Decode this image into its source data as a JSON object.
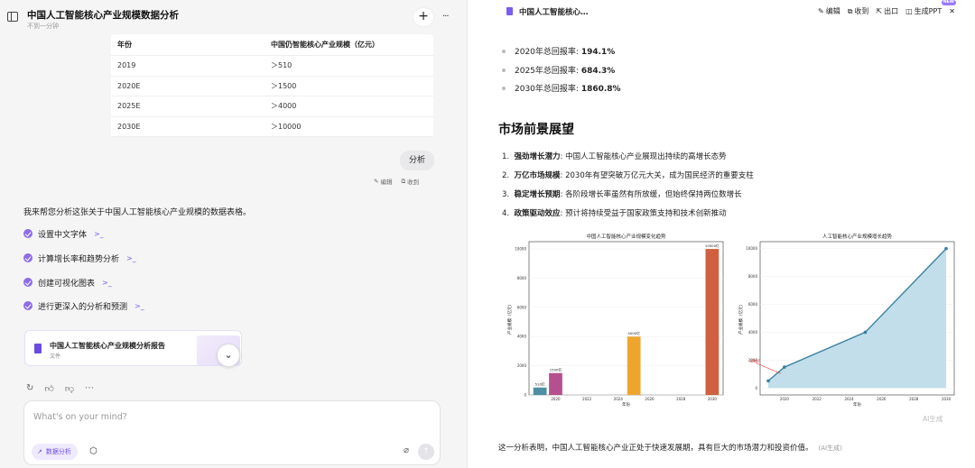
{
  "left": {
    "title": "中国人工智能核心产业规模数据分析",
    "subtitle": "不到一分钟",
    "table": {
      "headers": [
        "年份",
        "中国仍智能核心产业规模（亿元）"
      ],
      "rows": [
        [
          "2019",
          "＞510"
        ],
        [
          "2020E",
          "＞1500"
        ],
        [
          "2025E",
          "＞4000"
        ],
        [
          "2030E",
          "＞10000"
        ]
      ]
    },
    "user_message": "分析",
    "edit_label": "编辑",
    "collect_label": "收到",
    "ai_intro": "我来帮您分析这张关于中国人工智能核心产业规模的数据表格。",
    "steps": [
      "设置中文字体",
      "计算增长率和趋势分析",
      "创建可视化图表",
      "进行更深入的分析和预测"
    ],
    "file_card": {
      "title": "中国人工智能核心产业规模分析报告",
      "type": "文件"
    },
    "composer_placeholder": "What's on your mind?",
    "composer_tag": "数据分析"
  },
  "right": {
    "doc_title": "中国人工智能核心…",
    "header_buttons": [
      "编辑",
      "收到",
      "出口",
      "生成PPT"
    ],
    "new_badge": "NEW",
    "returns": [
      {
        "label": "2020年总回报率:",
        "value": "194.1%"
      },
      {
        "label": "2025年总回报率:",
        "value": "684.3%"
      },
      {
        "label": "2030年总回报率:",
        "value": "1860.8%"
      }
    ],
    "section_title": "市场前景展望",
    "outlook": [
      {
        "num": "1.",
        "bold": "强劲增长潜力",
        "text": ": 中国人工智能核心产业展现出持续的高增长态势"
      },
      {
        "num": "2.",
        "bold": "万亿市场规模",
        "text": ": 2030年有望突破万亿元大关，成为国民经济的重要支柱"
      },
      {
        "num": "3.",
        "bold": "稳定增长预期",
        "text": ": 各阶段增长率虽然有所放缓，但始终保持两位数增长"
      },
      {
        "num": "4.",
        "bold": "政策驱动效应",
        "text": ": 预计将持续受益于国家政策支持和技术创新推动"
      }
    ],
    "ai_generated_label": "AI生成",
    "conclusion": "这一分析表明，中国人工智能核心产业正处于快速发展期，具有巨大的市场潜力和投资价值。",
    "conclusion_tag": "(AI生成)"
  },
  "chart_data": [
    {
      "type": "bar",
      "title": "中国人工智能核心产业规模变化趋势",
      "xlabel": "年份",
      "ylabel": "产业规模（亿元）",
      "x": [
        2019,
        2020,
        2025,
        2030
      ],
      "values": [
        510,
        1500,
        4000,
        10000
      ],
      "data_labels": [
        "510亿",
        "1500亿",
        "4000亿",
        "10000亿"
      ],
      "colors": [
        "#4e8fa3",
        "#b5508e",
        "#eea52e",
        "#d0603f"
      ],
      "xticks": [
        2020,
        2022,
        2024,
        2026,
        2028,
        2030
      ],
      "yticks": [
        0,
        2000,
        4000,
        6000,
        8000,
        10000
      ],
      "ylim": [
        0,
        10500
      ],
      "xlim": [
        2018.3,
        2030.7
      ]
    },
    {
      "type": "area",
      "title": "人工智能核心产业规模增长趋势",
      "xlabel": "年份",
      "ylabel": "产业规模（亿元）",
      "x": [
        2019,
        2020,
        2025,
        2030
      ],
      "values": [
        510,
        1500,
        4000,
        10000
      ],
      "annotation": "起始点",
      "xticks": [
        2020,
        2022,
        2024,
        2026,
        2028,
        2030
      ],
      "yticks": [
        0,
        2000,
        4000,
        6000,
        8000,
        10000
      ],
      "ylim": [
        -500,
        10500
      ],
      "xlim": [
        2018.5,
        2030.5
      ],
      "line_color": "#3a80a0",
      "fill_color": "#b6d8e6"
    }
  ]
}
